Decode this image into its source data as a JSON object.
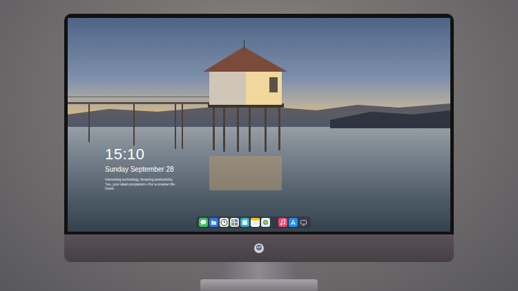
{
  "lock_screen": {
    "time": "15:10",
    "date": "Sunday September 28",
    "tagline": "Interesting technology, Amazing productivity. Yes, your ideal companion • For a smarter life. Good."
  },
  "dock": {
    "apps": [
      {
        "kind": "messages"
      },
      {
        "kind": "files"
      },
      {
        "kind": "clock"
      },
      {
        "kind": "gallery"
      },
      {
        "kind": "video"
      },
      {
        "kind": "notes"
      },
      {
        "kind": "photos"
      }
    ],
    "extras": [
      {
        "kind": "music"
      },
      {
        "kind": "store"
      },
      {
        "kind": "tv"
      }
    ]
  }
}
